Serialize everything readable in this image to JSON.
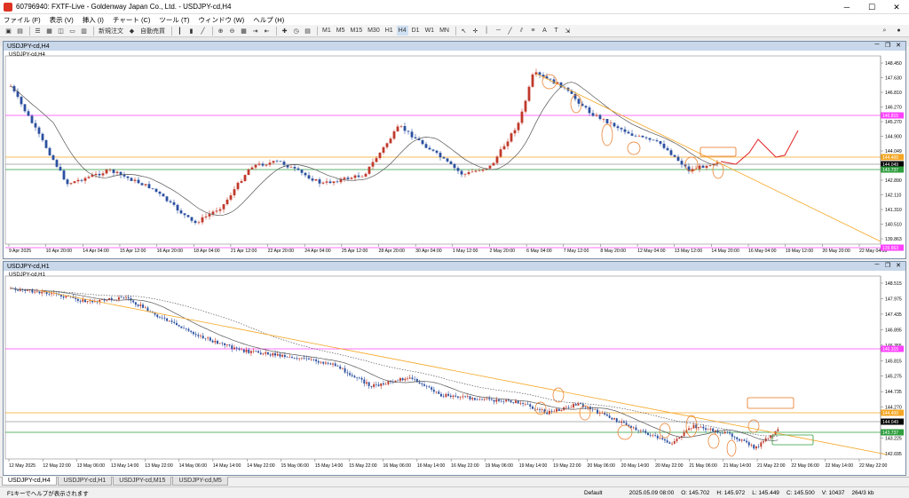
{
  "window": {
    "title": "60796940: FXTF-Live - Goldenway Japan Co., Ltd. - USDJPY-cd,H4"
  },
  "menu": [
    "ファイル (F)",
    "表示 (V)",
    "挿入 (I)",
    "チャート (C)",
    "ツール (T)",
    "ウィンドウ (W)",
    "ヘルプ (H)"
  ],
  "toolbar": {
    "new_order": "新規注文",
    "auto_trade": "自動売買",
    "timeframes": [
      "M1",
      "M5",
      "M15",
      "M30",
      "H1",
      "H4",
      "D1",
      "W1",
      "MN"
    ]
  },
  "chart_top": {
    "window_title": "USDJPY-cd,H4",
    "symbol": "USDJPY-cd,H4",
    "price_labels": [
      "148.450",
      "147.630",
      "146.810",
      "146.270",
      "145.270",
      "144.900",
      "144.049",
      "143.737",
      "142.890",
      "142.110",
      "141.310",
      "140.510",
      "139.863"
    ],
    "highlight_labels": {
      "magenta": "146.815",
      "orange": "144.400",
      "current": "144.049",
      "green": "143.737",
      "bottom": "139.863"
    },
    "time_labels": [
      "9 Apr 2025",
      "10 Apr 20:00",
      "14 Apr 04:00",
      "15 Apr 12:00",
      "16 Apr 20:00",
      "18 Apr 04:00",
      "21 Apr 12:00",
      "22 Apr 20:00",
      "24 Apr 04:00",
      "25 Apr 12:00",
      "28 Apr 20:00",
      "30 Apr 04:00",
      "1 May 12:00",
      "2 May 20:00",
      "6 May 04:00",
      "7 May 12:00",
      "8 May 20:00",
      "12 May 04:00",
      "13 May 12:00",
      "14 May 20:00",
      "16 May 04:00",
      "19 May 12:00",
      "20 May 20:00",
      "22 May 04:00"
    ]
  },
  "chart_bottom": {
    "window_title": "USDJPY-cd,H1",
    "symbol": "USDJPY-cd,H1",
    "price_labels": [
      "148.515",
      "147.975",
      "147.435",
      "146.895",
      "146.355",
      "145.815",
      "145.275",
      "144.735",
      "144.270",
      "143.735",
      "143.225",
      "142.695"
    ],
    "highlight_labels": {
      "magenta": "146.315",
      "orange": "144.400",
      "current": "144.049",
      "green": "143.737"
    },
    "time_labels": [
      "12 May 2025",
      "12 May 22:00",
      "13 May 06:00",
      "13 May 14:00",
      "13 May 22:00",
      "14 May 06:00",
      "14 May 14:00",
      "14 May 22:00",
      "15 May 06:00",
      "15 May 14:00",
      "15 May 22:00",
      "16 May 06:00",
      "16 May 14:00",
      "16 May 22:00",
      "19 May 06:00",
      "19 May 14:00",
      "19 May 22:00",
      "20 May 06:00",
      "20 May 14:00",
      "20 May 22:00",
      "21 May 06:00",
      "21 May 14:00",
      "21 May 22:00",
      "22 May 06:00",
      "22 May 14:00",
      "22 May 22:00"
    ]
  },
  "tabs": [
    "USDJPY-cd,H4",
    "USDJPY-cd,H1",
    "USDJPY-cd,M15",
    "USDJPY-cd,M5"
  ],
  "status": {
    "help": "F1キーでヘルプが表示されます",
    "profile": "Default",
    "datetime": "2025.05.09 08:00",
    "open": "O: 145.702",
    "high": "H: 145.972",
    "low": "L: 145.449",
    "close": "C: 145.500",
    "volume": "V: 10437",
    "traffic": "264/3 kb"
  },
  "colors": {
    "bull": "#c0392b",
    "bear": "#2b50a0",
    "magenta": "#ff40ff",
    "orange": "#f5a623",
    "green": "#2e9e3e",
    "ma": "#555555",
    "forecast": "#e02020"
  }
}
